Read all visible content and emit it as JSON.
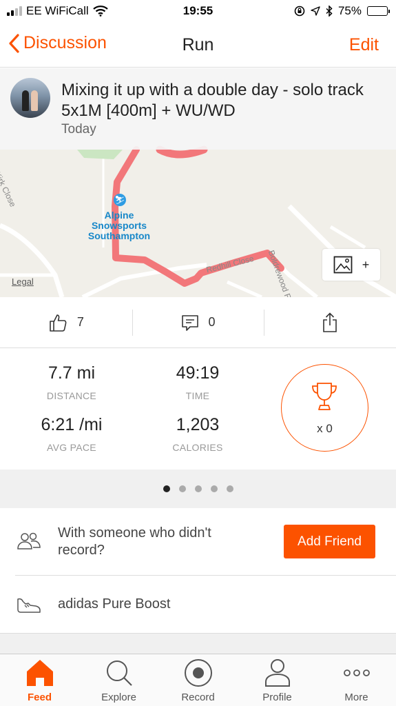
{
  "status_bar": {
    "carrier": "EE WiFiCall",
    "time": "19:55",
    "battery": "75%"
  },
  "nav": {
    "back_label": "Discussion",
    "title": "Run",
    "edit_label": "Edit"
  },
  "activity": {
    "title": "Mixing it up with a double day - solo track 5x1M [400m] + WU/WD",
    "date": "Today"
  },
  "map": {
    "poi_label": "Alpine Snowsports Southampton",
    "streets": [
      "Boldrewood Rd",
      "Redhill Close",
      "Kirk Close"
    ],
    "legal": "Legal",
    "expand_plus": "+",
    "route_color": "#f2777a"
  },
  "actions": {
    "kudos_count": "7",
    "comment_count": "0"
  },
  "stats": [
    {
      "value": "7.7 mi",
      "label": "DISTANCE"
    },
    {
      "value": "49:19",
      "label": "TIME"
    },
    {
      "value": "6:21 /mi",
      "label": "AVG PACE"
    },
    {
      "value": "1,203",
      "label": "CALORIES"
    }
  ],
  "achievements": {
    "count": "x 0"
  },
  "pager": {
    "pages": 5,
    "active": 1
  },
  "with_friend": {
    "text": "With someone who didn't record?",
    "button_label": "Add Friend"
  },
  "gear": {
    "name": "adidas Pure Boost"
  },
  "tabs": [
    {
      "label": "Feed",
      "icon": "home-icon",
      "active": true
    },
    {
      "label": "Explore",
      "icon": "search-icon",
      "active": false
    },
    {
      "label": "Record",
      "icon": "record-icon",
      "active": false
    },
    {
      "label": "Profile",
      "icon": "profile-icon",
      "active": false
    },
    {
      "label": "More",
      "icon": "more-icon",
      "active": false
    }
  ],
  "colors": {
    "accent": "#fc5200"
  }
}
